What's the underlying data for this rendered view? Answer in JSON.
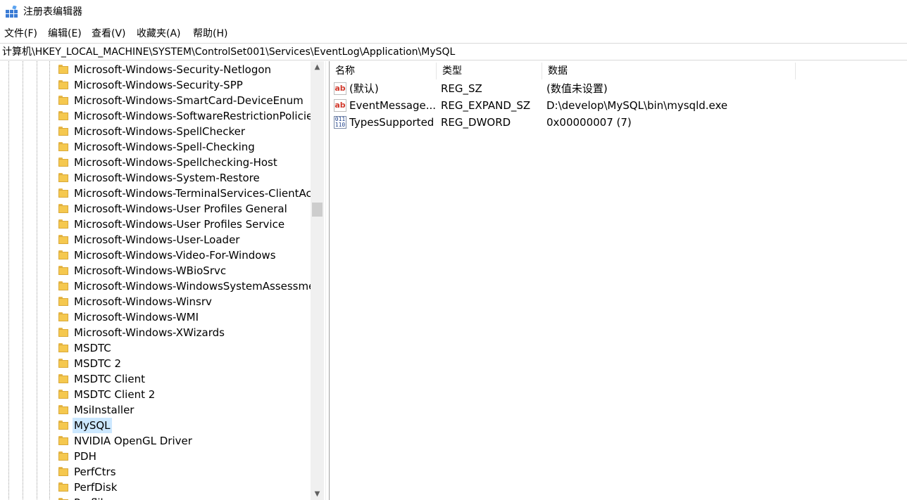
{
  "window": {
    "title": "注册表编辑器"
  },
  "menu": [
    {
      "label": "文件(F)",
      "name": "menu-file"
    },
    {
      "label": "编辑(E)",
      "name": "menu-edit"
    },
    {
      "label": "查看(V)",
      "name": "menu-view"
    },
    {
      "label": "收藏夹(A)",
      "name": "menu-favorites"
    },
    {
      "label": "帮助(H)",
      "name": "menu-help"
    }
  ],
  "address": "计算机\\HKEY_LOCAL_MACHINE\\SYSTEM\\ControlSet001\\Services\\EventLog\\Application\\MySQL",
  "tree": {
    "items": [
      {
        "label": "Microsoft-Windows-Security-Netlogon"
      },
      {
        "label": "Microsoft-Windows-Security-SPP"
      },
      {
        "label": "Microsoft-Windows-SmartCard-DeviceEnum"
      },
      {
        "label": "Microsoft-Windows-SoftwareRestrictionPolicies"
      },
      {
        "label": "Microsoft-Windows-SpellChecker"
      },
      {
        "label": "Microsoft-Windows-Spell-Checking"
      },
      {
        "label": "Microsoft-Windows-Spellchecking-Host"
      },
      {
        "label": "Microsoft-Windows-System-Restore"
      },
      {
        "label": "Microsoft-Windows-TerminalServices-ClientActiveXCore"
      },
      {
        "label": "Microsoft-Windows-User Profiles General"
      },
      {
        "label": "Microsoft-Windows-User Profiles Service"
      },
      {
        "label": "Microsoft-Windows-User-Loader"
      },
      {
        "label": "Microsoft-Windows-Video-For-Windows"
      },
      {
        "label": "Microsoft-Windows-WBioSrvc"
      },
      {
        "label": "Microsoft-Windows-WindowsSystemAssessmentTool"
      },
      {
        "label": "Microsoft-Windows-Winsrv"
      },
      {
        "label": "Microsoft-Windows-WMI"
      },
      {
        "label": "Microsoft-Windows-XWizards"
      },
      {
        "label": "MSDTC"
      },
      {
        "label": "MSDTC 2"
      },
      {
        "label": "MSDTC Client"
      },
      {
        "label": "MSDTC Client 2"
      },
      {
        "label": "MsiInstaller"
      },
      {
        "label": "MySQL",
        "selected": true
      },
      {
        "label": "NVIDIA OpenGL Driver"
      },
      {
        "label": "PDH"
      },
      {
        "label": "PerfCtrs"
      },
      {
        "label": "PerfDisk"
      },
      {
        "label": "Perflib"
      }
    ]
  },
  "list": {
    "columns": [
      "名称",
      "类型",
      "数据"
    ],
    "rows": [
      {
        "icon": "string-value-icon",
        "icon_text": "ab",
        "name": "(默认)",
        "type": "REG_SZ",
        "data": "(数值未设置)"
      },
      {
        "icon": "string-value-icon",
        "icon_text": "ab",
        "name": "EventMessage...",
        "type": "REG_EXPAND_SZ",
        "data": "D:\\develop\\MySQL\\bin\\mysqld.exe"
      },
      {
        "icon": "binary-value-icon",
        "icon_text": "011\n110",
        "name": "TypesSupported",
        "type": "REG_DWORD",
        "data": "0x00000007 (7)"
      }
    ]
  }
}
